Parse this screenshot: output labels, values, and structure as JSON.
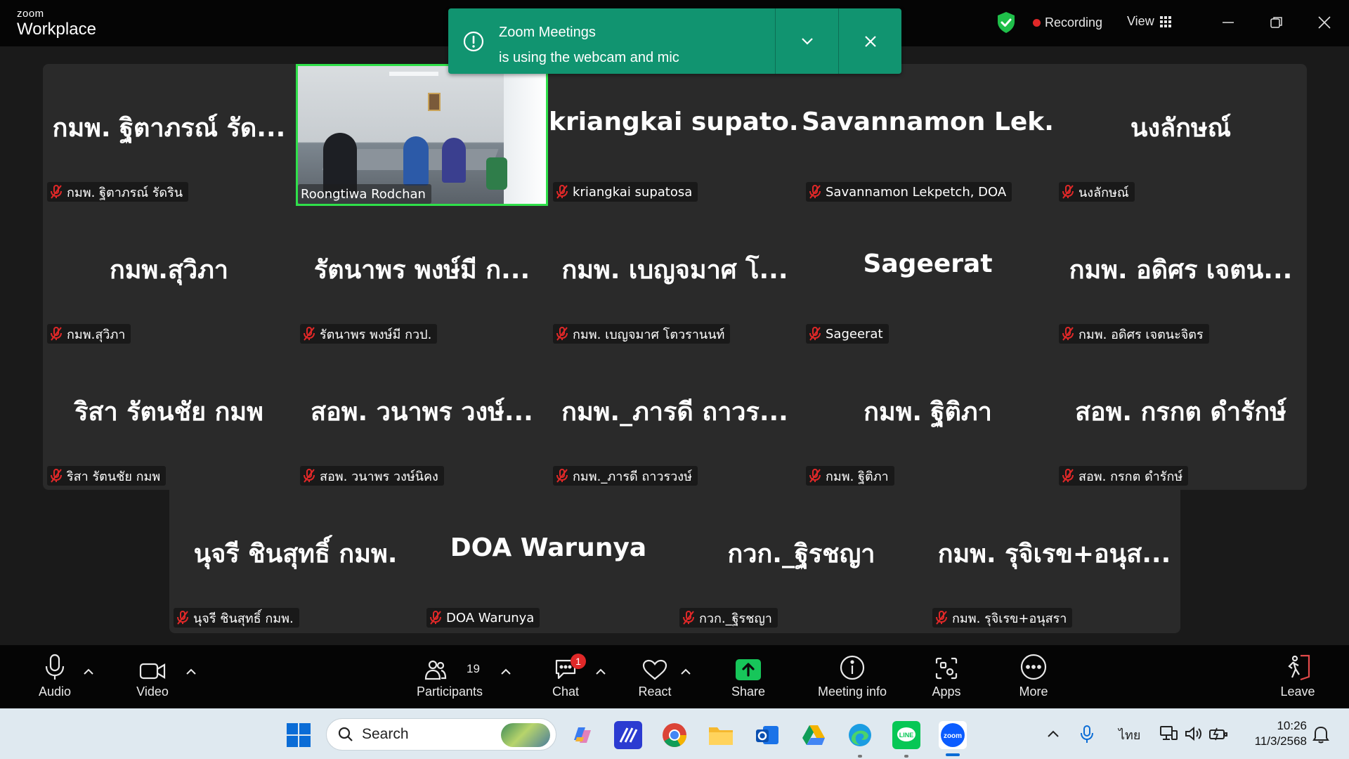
{
  "app": {
    "brand_small": "zoom",
    "brand_big": "Workplace"
  },
  "topbar": {
    "recording_label": "Recording",
    "view_label": "View"
  },
  "toast": {
    "title": "Zoom Meetings",
    "message": "is using the webcam and mic"
  },
  "participants": [
    {
      "title": "กมพ. ฐิตาภรณ์ รัด...",
      "name": "กมพ. ฐิตาภรณ์ รัดริน",
      "muted": true
    },
    {
      "title": "",
      "name": "Roongtiwa Rodchan",
      "muted": false,
      "video": true
    },
    {
      "title": "kriangkai supato...",
      "name": "kriangkai supatosa",
      "muted": true
    },
    {
      "title": "Savannamon Lek...",
      "name": "Savannamon Lekpetch, DOA",
      "muted": true
    },
    {
      "title": "นงลักษณ์",
      "name": "นงลักษณ์",
      "muted": true
    },
    {
      "title": "กมพ.สุวิภา",
      "name": "กมพ.สุวิภา",
      "muted": true
    },
    {
      "title": "รัตนาพร พงษ์มี ก...",
      "name": "รัตนาพร พงษ์มี กวป.",
      "muted": true
    },
    {
      "title": "กมพ. เบญจมาศ โ...",
      "name": "กมพ. เบญจมาศ โตวรานนท์",
      "muted": true
    },
    {
      "title": "Sageerat",
      "name": "Sageerat",
      "muted": true
    },
    {
      "title": "กมพ. อดิศร เจตน...",
      "name": "กมพ. อดิศร เจตนะจิตร",
      "muted": true
    },
    {
      "title": "ริสา รัตนชัย กมพ",
      "name": "ริสา รัตนชัย กมพ",
      "muted": true
    },
    {
      "title": "สอพ. วนาพร วงษ์...",
      "name": "สอพ. วนาพร วงษ์นิคง",
      "muted": true
    },
    {
      "title": "กมพ._ภารดี ถาวร...",
      "name": "กมพ._ภารดี ถาวรวงษ์",
      "muted": true
    },
    {
      "title": "กมพ. ฐิติภา",
      "name": "กมพ. ฐิติภา",
      "muted": true
    },
    {
      "title": "สอพ. กรกต ดำรักษ์",
      "name": "สอพ. กรกต ดำรักษ์",
      "muted": true
    },
    {
      "title": "นุจรี ชินสุทธิ์ กมพ.",
      "name": "นุจรี ชินสุทธิ์ กมพ.",
      "muted": true
    },
    {
      "title": "DOA Warunya",
      "name": "DOA Warunya",
      "muted": true
    },
    {
      "title": "กวก._ฐิรชญา",
      "name": "กวก._ฐิรชญา",
      "muted": true
    },
    {
      "title": "กมพ. รุจิเรข+อนุส...",
      "name": "กมพ. รุจิเรข+อนุสรา",
      "muted": true
    }
  ],
  "toolbar": {
    "audio": "Audio",
    "video": "Video",
    "participants": "Participants",
    "participants_count": "19",
    "chat": "Chat",
    "chat_badge": "1",
    "react": "React",
    "share": "Share",
    "meeting_info": "Meeting info",
    "apps": "Apps",
    "more": "More",
    "leave": "Leave"
  },
  "taskbar": {
    "search_placeholder": "Search",
    "language": "ไทย",
    "time": "10:26",
    "date": "11/3/2568",
    "apps": [
      "start-icon",
      "copilot-icon",
      "ai-app-icon",
      "chrome-icon",
      "file-explorer-icon",
      "outlook-icon",
      "google-drive-icon",
      "edge-icon",
      "line-icon",
      "zoom-icon"
    ]
  },
  "colors": {
    "toast_bg": "#119470",
    "active_speaker": "#2fe04a",
    "muted_icon": "#e02828",
    "share_green": "#17c65a",
    "tile_bg": "#2a2a2a"
  }
}
